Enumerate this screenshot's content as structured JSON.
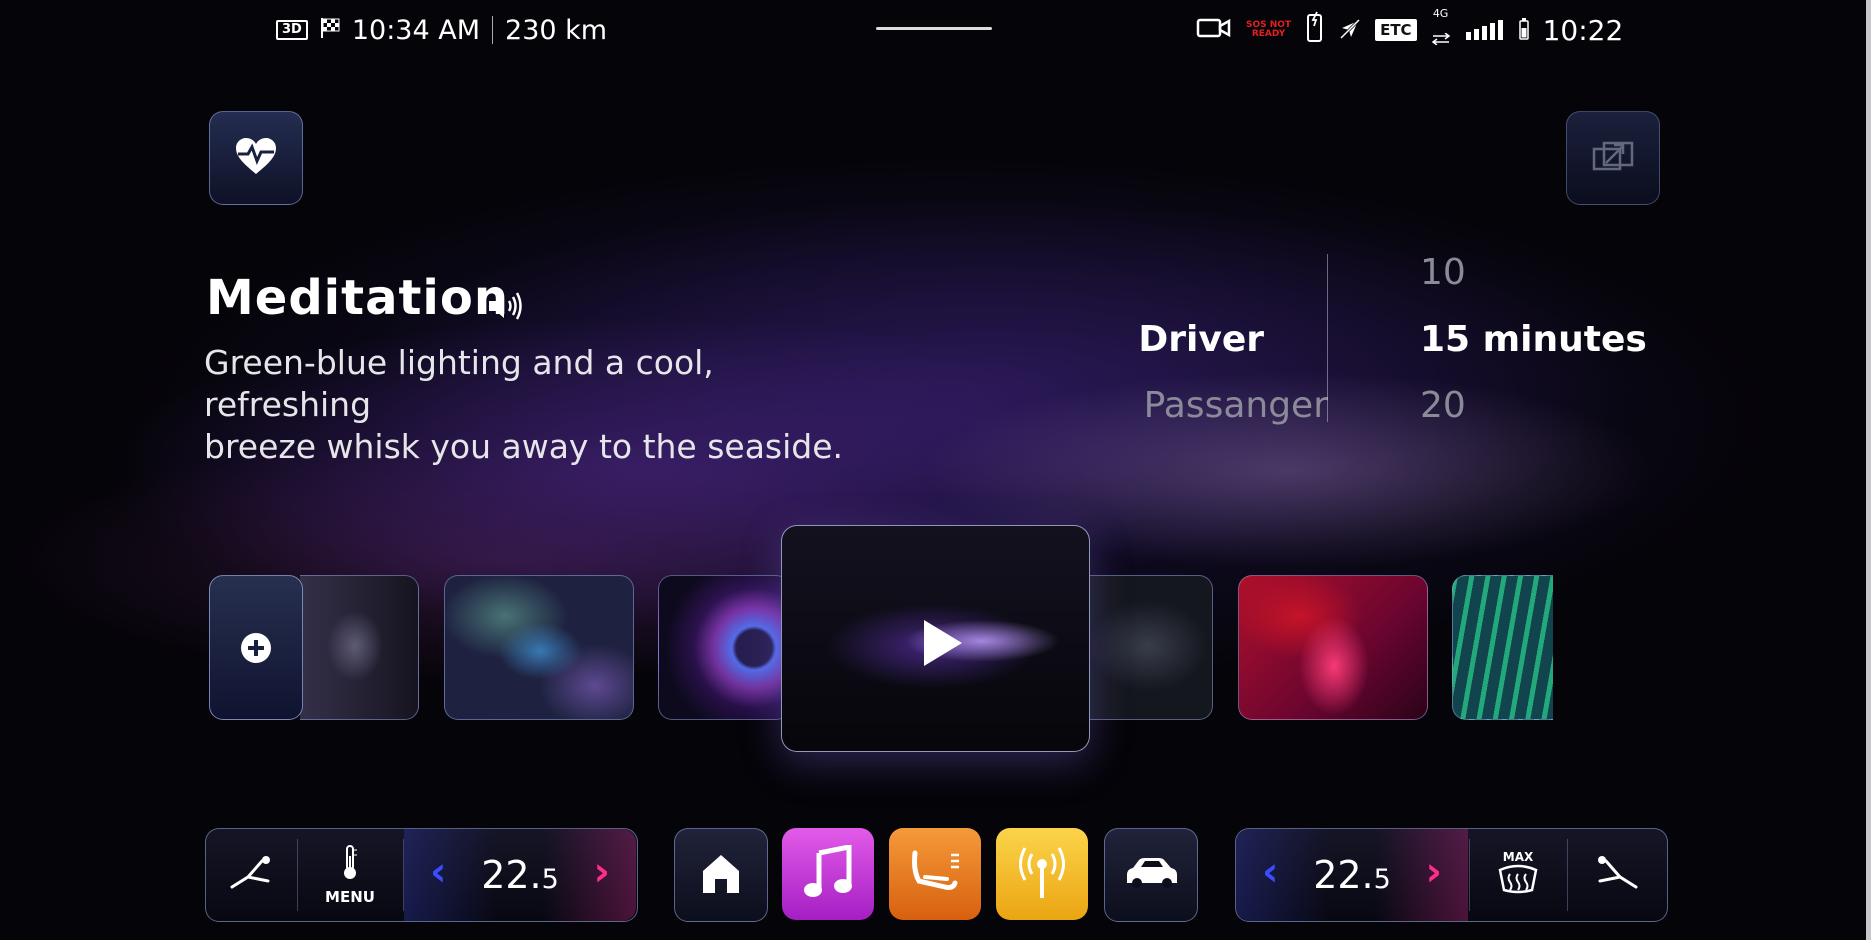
{
  "status_bar": {
    "left": {
      "badge_3d": "3D",
      "time": "10:34 AM",
      "distance": "230 km"
    },
    "right": {
      "sos_line1": "SOS NOT",
      "sos_line2": "READY",
      "etc": "ETC",
      "network": "4G",
      "clock": "10:22"
    }
  },
  "program": {
    "title": "Meditation",
    "description_line1": "Green-blue lighting and a cool, refreshing",
    "description_line2": "breeze whisk you away to the seaside."
  },
  "seat_picker": {
    "options": [
      "Driver",
      "Passanger"
    ],
    "selected": "Driver"
  },
  "duration_picker": {
    "above": "10",
    "selected_value": "15",
    "selected_unit": "minutes",
    "below": "20"
  },
  "climate": {
    "left_temp_int": "22.",
    "left_temp_dec": "5",
    "right_temp_int": "22.",
    "right_temp_dec": "5",
    "menu_label": "MENU",
    "max_label": "MAX"
  },
  "colors": {
    "accent_blue": "#3b4bff",
    "accent_pink": "#ff2d8a",
    "music": "#c23ad6",
    "seat": "#e8761c",
    "radio": "#f2b71a"
  },
  "icons": {
    "health": "heart-pulse-icon",
    "expand": "expand-icon",
    "add": "plus-circle-icon",
    "play": "play-icon",
    "speaker": "speaker-icon",
    "home": "home-icon",
    "music": "music-note-icon",
    "seat": "seat-massage-icon",
    "radio": "radio-antenna-icon",
    "car": "car-icon",
    "defrost": "rear-defrost-icon"
  }
}
